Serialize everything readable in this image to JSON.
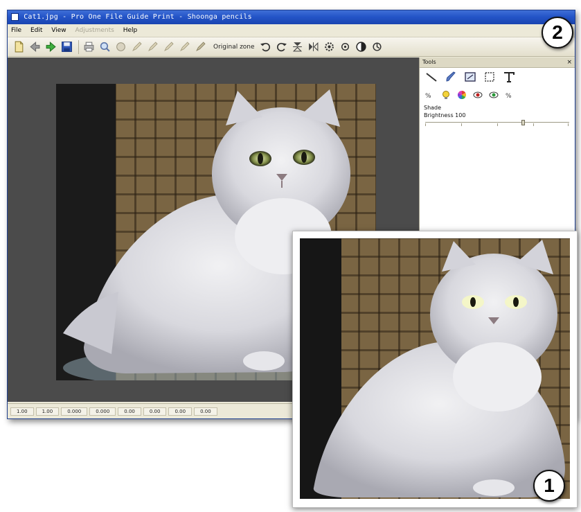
{
  "window": {
    "title": "Cat1.jpg - Pro One File Guide Print - Shoonga pencils",
    "menu": [
      "File",
      "Edit",
      "View",
      "Adjustments",
      "Help"
    ],
    "menu_disabled": [
      false,
      false,
      false,
      true,
      false
    ]
  },
  "toolbar": {
    "icons": [
      "new-file-icon",
      "back-arrow-icon",
      "forward-arrow-icon",
      "save-icon",
      "print-icon",
      "zoom-icon",
      "paint-brush-icon",
      "pencil-icon",
      "pencil-icon",
      "pencil-icon",
      "pencil-icon",
      "pencil-icon"
    ],
    "label": "Original zone",
    "right_icons": [
      "rotate-left-icon",
      "rotate-right-icon",
      "flip-vertical-icon",
      "flip-horizontal-icon",
      "gear-icon",
      "target-icon",
      "contrast-icon",
      "adjust-icon"
    ]
  },
  "tools_panel": {
    "title": "Tools",
    "close": "×",
    "section_label": "Shade",
    "value_label": "Brightness 100"
  },
  "statusbar": {
    "cells": [
      "1.00",
      "1.00",
      "0.000",
      "0.000",
      "0.00",
      "0.00",
      "0.00",
      "0.00"
    ]
  },
  "callouts": {
    "one": "1",
    "two": "2"
  },
  "colors": {
    "titlebar": "#2455c8",
    "workspace": "#4b4b4b",
    "panel": "#ffffff"
  }
}
